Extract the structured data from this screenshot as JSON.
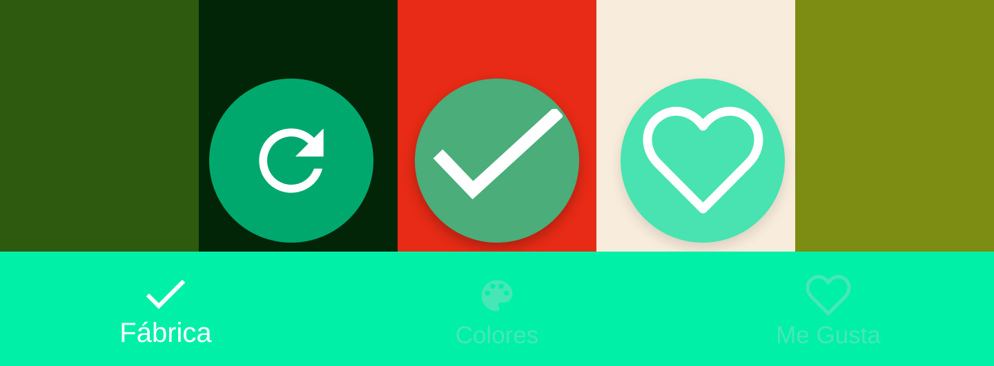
{
  "palette": {
    "swatches": [
      "#2d5a0e",
      "#022507",
      "#e72b16",
      "#f8ecdc",
      "#7d8c12"
    ]
  },
  "fabs": [
    {
      "icon": "refresh-icon",
      "color": "#00a86e"
    },
    {
      "icon": "check-icon",
      "color": "#4aad7a"
    },
    {
      "icon": "heart-outline-icon",
      "color": "#48e3b0"
    }
  ],
  "bottom_nav": {
    "background": "#00f0a8",
    "items": [
      {
        "label": "Fábrica",
        "icon": "check-icon",
        "active": true
      },
      {
        "label": "Colores",
        "icon": "palette-icon",
        "active": false
      },
      {
        "label": "Me Gusta",
        "icon": "heart-outline-icon",
        "active": false
      }
    ],
    "active_color": "#ffffff",
    "inactive_color": "#47e6b6"
  }
}
